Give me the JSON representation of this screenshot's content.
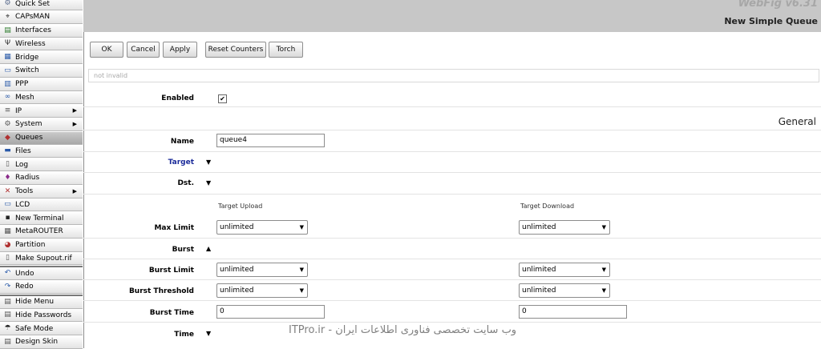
{
  "sidebar": {
    "items": [
      {
        "label": "Quick Set",
        "icon": "quick-set-icon",
        "glyph": "⚙",
        "color": "#5a6b8c"
      },
      {
        "label": "CAPsMAN",
        "icon": "capsman-icon",
        "glyph": "⌖",
        "color": "#333"
      },
      {
        "label": "Interfaces",
        "icon": "interfaces-icon",
        "glyph": "▤",
        "color": "#2a7a2a"
      },
      {
        "label": "Wireless",
        "icon": "wireless-icon",
        "glyph": "Ψ",
        "color": "#333"
      },
      {
        "label": "Bridge",
        "icon": "bridge-icon",
        "glyph": "▦",
        "color": "#2a5aa8"
      },
      {
        "label": "Switch",
        "icon": "switch-icon",
        "glyph": "▭",
        "color": "#2a5aa8"
      },
      {
        "label": "PPP",
        "icon": "ppp-icon",
        "glyph": "▥",
        "color": "#2a5aa8"
      },
      {
        "label": "Mesh",
        "icon": "mesh-icon",
        "glyph": "∞",
        "color": "#2a5aa8"
      },
      {
        "label": "IP",
        "icon": "ip-icon",
        "glyph": "≡",
        "color": "#555",
        "arrow": "▶"
      },
      {
        "label": "System",
        "icon": "system-icon",
        "glyph": "⚙",
        "color": "#555",
        "arrow": "▶"
      },
      {
        "label": "Queues",
        "icon": "queues-icon",
        "glyph": "◆",
        "color": "#b03030",
        "active": true
      },
      {
        "label": "Files",
        "icon": "files-icon",
        "glyph": "▬",
        "color": "#2a5aa8"
      },
      {
        "label": "Log",
        "icon": "log-icon",
        "glyph": "▯",
        "color": "#555"
      },
      {
        "label": "Radius",
        "icon": "radius-icon",
        "glyph": "♦",
        "color": "#8a2a8a"
      },
      {
        "label": "Tools",
        "icon": "tools-icon",
        "glyph": "✕",
        "color": "#b03030",
        "arrow": "▶"
      },
      {
        "label": "LCD",
        "icon": "lcd-icon",
        "glyph": "▭",
        "color": "#2a5aa8"
      },
      {
        "label": "New Terminal",
        "icon": "terminal-icon",
        "glyph": "▪",
        "color": "#222"
      },
      {
        "label": "MetaROUTER",
        "icon": "metarouter-icon",
        "glyph": "▦",
        "color": "#555"
      },
      {
        "label": "Partition",
        "icon": "partition-icon",
        "glyph": "◕",
        "color": "#b03030"
      },
      {
        "label": "Make Supout.rif",
        "icon": "supout-icon",
        "glyph": "▯",
        "color": "#555"
      },
      {
        "label": "Undo",
        "icon": "undo-icon",
        "glyph": "↶",
        "color": "#2a5aa8"
      },
      {
        "label": "Redo",
        "icon": "redo-icon",
        "glyph": "↷",
        "color": "#2a5aa8"
      },
      {
        "label": "Hide Menu",
        "icon": "hide-menu-icon",
        "glyph": "▤",
        "color": "#555"
      },
      {
        "label": "Hide Passwords",
        "icon": "hide-passwords-icon",
        "glyph": "▤",
        "color": "#555"
      },
      {
        "label": "Safe Mode",
        "icon": "safe-mode-icon",
        "glyph": "☂",
        "color": "#222"
      },
      {
        "label": "Design Skin",
        "icon": "design-skin-icon",
        "glyph": "▤",
        "color": "#555"
      }
    ]
  },
  "header": {
    "brand": "WebFig v6.31",
    "title": "New Simple Queue"
  },
  "toolbar": {
    "ok": "OK",
    "cancel": "Cancel",
    "apply": "Apply",
    "reset_counters": "Reset Counters",
    "torch": "Torch"
  },
  "status": {
    "text": "not invalid"
  },
  "form": {
    "enabled_label": "Enabled",
    "enabled_checked": true,
    "enabled_mark": "✔",
    "section_general": "General",
    "name_label": "Name",
    "name_value": "queue4",
    "target_label": "Target",
    "dst_label": "Dst.",
    "col_upload": "Target Upload",
    "col_download": "Target Download",
    "max_limit_label": "Max Limit",
    "max_limit_upload": "unlimited",
    "max_limit_download": "unlimited",
    "burst_label": "Burst",
    "burst_limit_label": "Burst Limit",
    "burst_limit_upload": "unlimited",
    "burst_limit_download": "unlimited",
    "burst_threshold_label": "Burst Threshold",
    "burst_threshold_upload": "unlimited",
    "burst_threshold_download": "unlimited",
    "burst_time_label": "Burst Time",
    "burst_time_upload": "0",
    "burst_time_download": "0",
    "time_label": "Time",
    "collapsed_glyph": "▼",
    "expanded_glyph": "▲",
    "select_glyph": "▼"
  },
  "watermark": "ITPro.ir - وب سایت تخصصی فناوری اطلاعات ایران"
}
